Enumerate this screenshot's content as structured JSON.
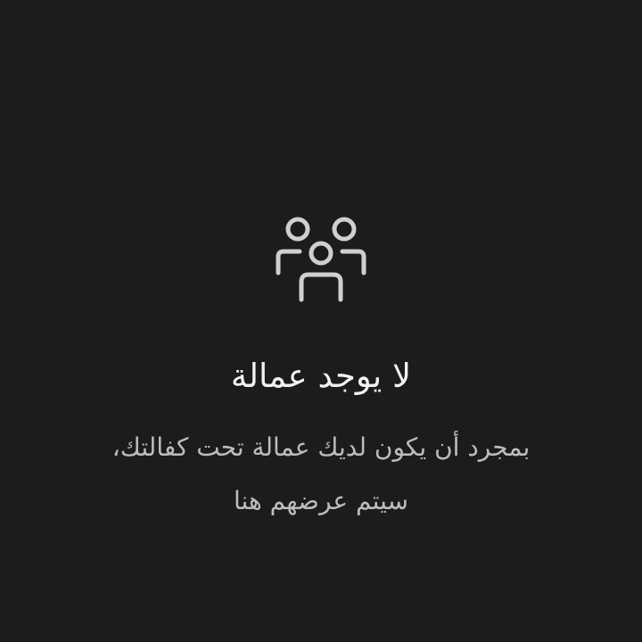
{
  "empty_state": {
    "icon": "people-group-icon",
    "title": "لا يوجد عمالة",
    "message_line1": "بمجرد أن يكون لديك عمالة تحت كفالتك،",
    "message_line2": "سيتم عرضهم هنا"
  },
  "colors": {
    "background": "#1c1c1c",
    "title": "#f2f2f2",
    "message": "#bdbdbd",
    "icon": "#cfcfcf"
  }
}
